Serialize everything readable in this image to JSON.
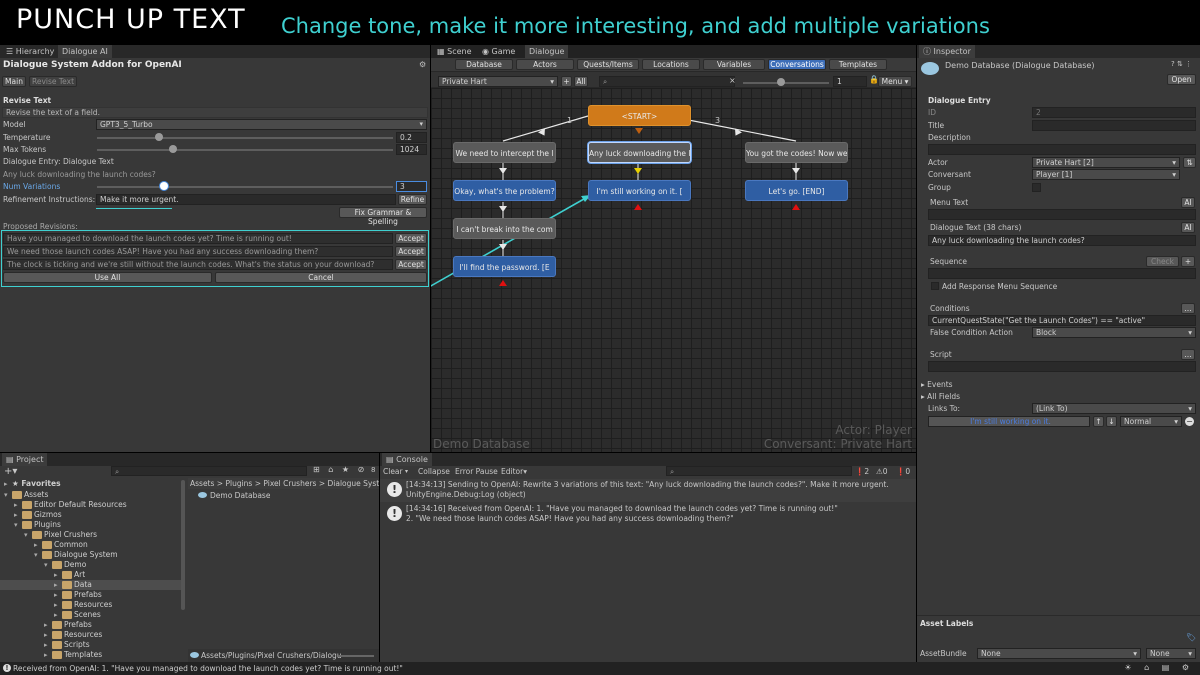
{
  "banner": {
    "title": "PUNCH UP TEXT",
    "subtitle": "Change tone, make it more interesting, and add multiple variations"
  },
  "left_panel": {
    "tabs": [
      "Hierarchy",
      "Dialogue AI"
    ],
    "header": "Dialogue System Addon for OpenAI",
    "mode_buttons": [
      "Main",
      "Revise Text"
    ],
    "section": "Revise Text",
    "hint": "Revise the text of a field.",
    "model_label": "Model",
    "model_value": "GPT3_5_Turbo",
    "temperature_label": "Temperature",
    "temperature_value": "0.2",
    "max_tokens_label": "Max Tokens",
    "max_tokens_value": "1024",
    "entry_label": "Dialogue Entry: Dialogue Text",
    "entry_text": "Any luck downloading the launch codes?",
    "num_variations_label": "Num Variations",
    "num_variations_value": "3",
    "refinement_label": "Refinement Instructions:",
    "refinement_value": "Make it more urgent.",
    "refine_btn": "Refine",
    "grammar_btn": "Fix Grammar & Spelling",
    "proposed_label": "Proposed Revisions:",
    "revisions": [
      "Have you managed to download the launch codes yet? Time is running out!",
      "We need those launch codes ASAP! Have you had any success downloading them?",
      "The clock is ticking and we're still without the launch codes. What's the status on your download?"
    ],
    "accept_btn": "Accept",
    "use_all_btn": "Use All",
    "cancel_btn": "Cancel"
  },
  "graph": {
    "tabs": [
      "Scene",
      "Game",
      "Dialogue"
    ],
    "toolbar": [
      "Database",
      "Actors",
      "Quests/Items",
      "Locations",
      "Variables",
      "Conversations",
      "Templates"
    ],
    "conversation": "Private Hart",
    "zoom_value": "1",
    "menu": "Menu",
    "all_btn": "All",
    "nodes": {
      "start": "<START>",
      "n1": "We need to intercept the l",
      "n2": "Any luck downloading the l",
      "n3": "You got the codes! Now we",
      "n4": "Okay, what's the problem?",
      "n5": "I'm still working on it. [",
      "n6": "Let's go. [END]",
      "n7": "I can't break into the com",
      "n8": "I'll find the password. [E"
    },
    "link_labels": [
      "1",
      "3"
    ],
    "watermark": "Demo Database",
    "actor": "Actor: Player",
    "conversant": "Conversant: Private Hart"
  },
  "inspector": {
    "tab": "Inspector",
    "title": "Demo Database (Dialogue Database)",
    "open_btn": "Open",
    "section": "Dialogue Entry",
    "id_label": "ID",
    "id_value": "2",
    "title_label": "Title",
    "description_label": "Description",
    "actor_label": "Actor",
    "actor_value": "Private Hart [2]",
    "conversant_label": "Conversant",
    "conversant_value": "Player [1]",
    "group_label": "Group",
    "menu_text_label": "Menu Text",
    "dialogue_text_label": "Dialogue Text (38 chars)",
    "dialogue_text_value": "Any luck downloading the launch codes?",
    "ai_btn": "AI",
    "sequence_label": "Sequence",
    "check_btn": "Check",
    "add_response_label": "Add Response Menu Sequence",
    "conditions_label": "Conditions",
    "conditions_value": "CurrentQuestState(\"Get the Launch Codes\") == \"active\"",
    "false_action_label": "False Condition Action",
    "false_action_value": "Block",
    "script_label": "Script",
    "events_label": "Events",
    "all_fields_label": "All Fields",
    "links_to_label": "Links To:",
    "links_to_value": "(Link To)",
    "link_entry": "I'm still working on it.",
    "priority_value": "Normal",
    "asset_labels": "Asset Labels",
    "asset_bundle_label": "AssetBundle",
    "asset_bundle_value": "None",
    "asset_variant_value": "None"
  },
  "project": {
    "tab": "Project",
    "favorites": "Favorites",
    "tree": [
      {
        "label": "Assets",
        "depth": 0,
        "open": true
      },
      {
        "label": "Editor Default Resources",
        "depth": 1,
        "open": false
      },
      {
        "label": "Gizmos",
        "depth": 1,
        "open": false
      },
      {
        "label": "Plugins",
        "depth": 1,
        "open": true
      },
      {
        "label": "Pixel Crushers",
        "depth": 2,
        "open": true
      },
      {
        "label": "Common",
        "depth": 3,
        "open": false
      },
      {
        "label": "Dialogue System",
        "depth": 3,
        "open": true
      },
      {
        "label": "Demo",
        "depth": 4,
        "open": true
      },
      {
        "label": "Art",
        "depth": 5,
        "open": false
      },
      {
        "label": "Data",
        "depth": 5,
        "open": false,
        "selected": true
      },
      {
        "label": "Prefabs",
        "depth": 5,
        "open": false
      },
      {
        "label": "Resources",
        "depth": 5,
        "open": false
      },
      {
        "label": "Scenes",
        "depth": 5,
        "open": false
      },
      {
        "label": "Prefabs",
        "depth": 4,
        "open": false
      },
      {
        "label": "Resources",
        "depth": 4,
        "open": false
      },
      {
        "label": "Scripts",
        "depth": 4,
        "open": false
      },
      {
        "label": "Templates",
        "depth": 4,
        "open": false
      }
    ],
    "breadcrumb": "Assets > Plugins > Pixel Crushers > Dialogue Syster",
    "file": "Demo Database",
    "footer_path": "Assets/Plugins/Pixel Crushers/Dialogu",
    "hidden_count": "8"
  },
  "console": {
    "tab": "Console",
    "toolbar": [
      "Clear",
      "Collapse",
      "Error Pause",
      "Editor"
    ],
    "counts": [
      "2",
      "0",
      "0"
    ],
    "logs": [
      {
        "line1": "[14:34:13] Sending to OpenAI: Rewrite 3 variations of this text: \"Any luck downloading the launch codes?\". Make it more urgent.",
        "line2": "UnityEngine.Debug:Log (object)"
      },
      {
        "line1": "[14:34:16] Received from OpenAI: 1. \"Have you managed to download the launch codes yet? Time is running out!\"",
        "line2": "2. \"We need those launch codes ASAP! Have you had any success downloading them?\""
      }
    ]
  },
  "status_bar": "Received from OpenAI: 1. \"Have you managed to download the launch codes yet? Time is running out!\""
}
